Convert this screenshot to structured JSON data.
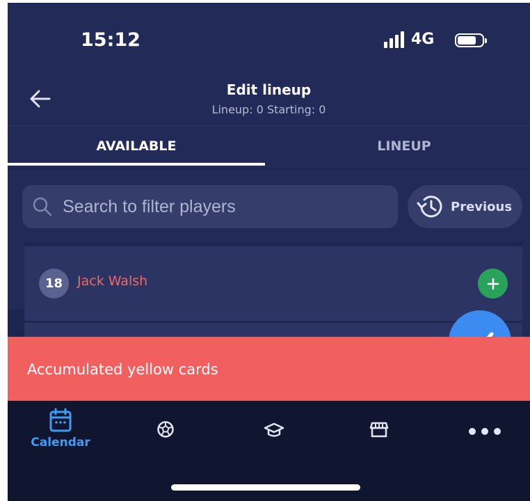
{
  "status_bar": {
    "time": "15:12",
    "network": "4G"
  },
  "header": {
    "title": "Edit lineup",
    "subtitle": "Lineup: 0 Starting: 0"
  },
  "tabs": [
    {
      "label": "AVAILABLE",
      "active": true
    },
    {
      "label": "LINEUP",
      "active": false
    }
  ],
  "search": {
    "placeholder": "Search to filter players"
  },
  "previous_button": {
    "label": "Previous"
  },
  "players": [
    {
      "number": "18",
      "name": "Jack Walsh",
      "name_color": "#ef6b67"
    }
  ],
  "toast": {
    "message": "Accumulated yellow cards",
    "color": "#f15f5e"
  },
  "bottom_nav": [
    {
      "label": "Calendar",
      "icon": "calendar-icon",
      "active": true
    },
    {
      "label": "",
      "icon": "soccer-ball-icon",
      "active": false
    },
    {
      "label": "",
      "icon": "graduation-cap-icon",
      "active": false
    },
    {
      "label": "",
      "icon": "store-icon",
      "active": false
    },
    {
      "label": "",
      "icon": "more-icon",
      "active": false
    }
  ],
  "colors": {
    "background": "#222b58",
    "accent": "#3d9cf5",
    "add": "#29a35a"
  }
}
